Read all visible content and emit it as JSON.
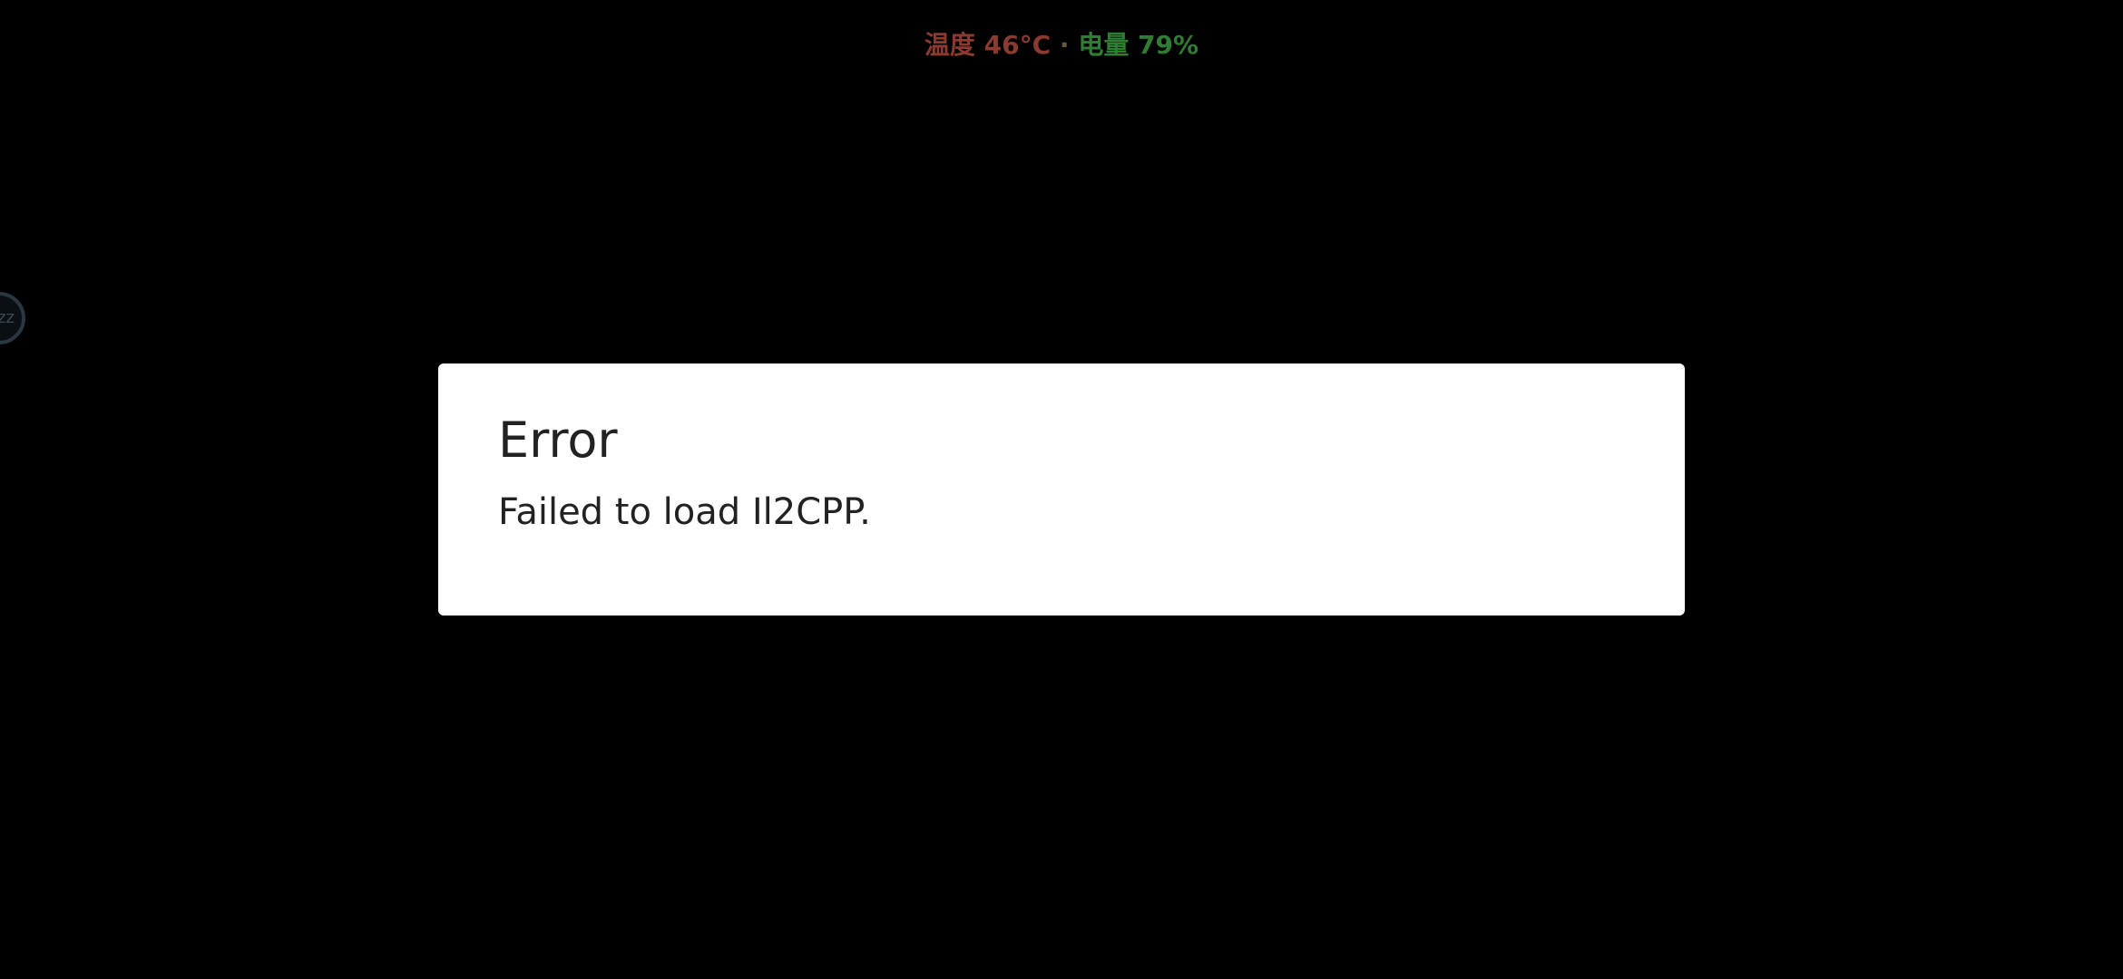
{
  "status_overlay": {
    "temperature": "温度 46°C",
    "separator": "·",
    "battery": "电量 79%",
    "colors": {
      "temperature": "#8a3a2e",
      "battery": "#2f7d32"
    }
  },
  "floating_ball": {
    "icon": "floating-ball-icon",
    "glyph": "zz"
  },
  "dialog": {
    "title": "Error",
    "message": "Failed to load Il2CPP."
  }
}
